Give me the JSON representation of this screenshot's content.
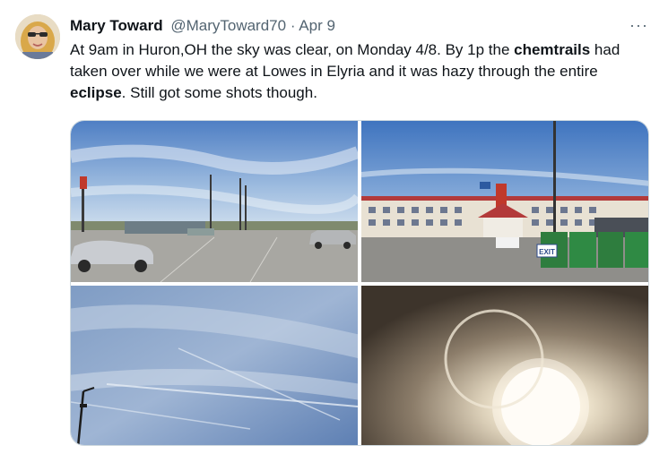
{
  "author": {
    "name": "Mary Toward",
    "handle": "@MaryToward70",
    "separator": "·",
    "date": "Apr 9"
  },
  "more_label": "···",
  "tweet": {
    "segments": [
      {
        "text": "At 9am in Huron,OH the sky was clear, on Monday 4/8. By 1p the ",
        "bold": false
      },
      {
        "text": "chemtrails",
        "bold": true
      },
      {
        "text": " had taken over while we were at Lowes in Elyria and it was hazy through the entire ",
        "bold": false
      },
      {
        "text": "eclipse",
        "bold": true
      },
      {
        "text": ". Still got some shots though.",
        "bold": false
      }
    ]
  },
  "media": {
    "photo2_sign": "EXIT"
  },
  "colors": {
    "name": "#0f1419",
    "secondary": "#536471",
    "border": "#cfd9de"
  }
}
